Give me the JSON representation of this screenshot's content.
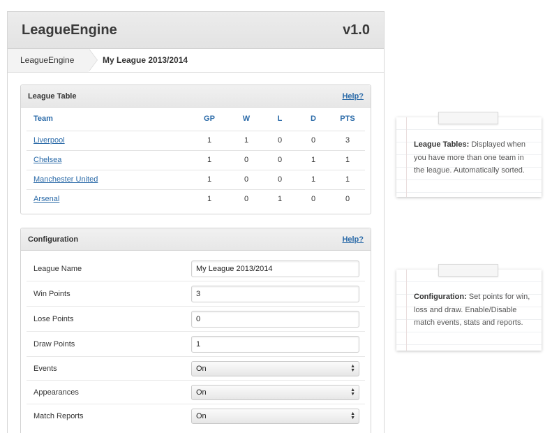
{
  "app": {
    "title": "LeagueEngine",
    "version": "v1.0"
  },
  "breadcrumb": {
    "home": "LeagueEngine",
    "current": "My League 2013/2014"
  },
  "league_table": {
    "title": "League Table",
    "help": "Help?",
    "columns": [
      "Team",
      "GP",
      "W",
      "L",
      "D",
      "PTS"
    ],
    "rows": [
      {
        "team": "Liverpool",
        "gp": "1",
        "w": "1",
        "l": "0",
        "d": "0",
        "pts": "3"
      },
      {
        "team": "Chelsea",
        "gp": "1",
        "w": "0",
        "l": "0",
        "d": "1",
        "pts": "1"
      },
      {
        "team": "Manchester United",
        "gp": "1",
        "w": "0",
        "l": "0",
        "d": "1",
        "pts": "1"
      },
      {
        "team": "Arsenal",
        "gp": "1",
        "w": "0",
        "l": "1",
        "d": "0",
        "pts": "0"
      }
    ]
  },
  "configuration": {
    "title": "Configuration",
    "help": "Help?",
    "league_name": {
      "label": "League Name",
      "value": "My League 2013/2014"
    },
    "win_points": {
      "label": "Win Points",
      "value": "3"
    },
    "lose_points": {
      "label": "Lose Points",
      "value": "0"
    },
    "draw_points": {
      "label": "Draw Points",
      "value": "1"
    },
    "events": {
      "label": "Events",
      "value": "On"
    },
    "appearances": {
      "label": "Appearances",
      "value": "On"
    },
    "match_reports": {
      "label": "Match Reports",
      "value": "On"
    }
  },
  "notes": {
    "league_tables": {
      "title": "League Tables:",
      "text": " Displayed when you have more than one team in the league. Automatically sorted."
    },
    "configuration": {
      "title": "Configuration:",
      "text": " Set points for win, loss and draw. Enable/Disable match events, stats and reports."
    }
  },
  "icons": {
    "select_arrows": "updown-arrows-icon"
  },
  "colors": {
    "link": "#2a6aa8",
    "header_bg": "#e8e8e8"
  }
}
